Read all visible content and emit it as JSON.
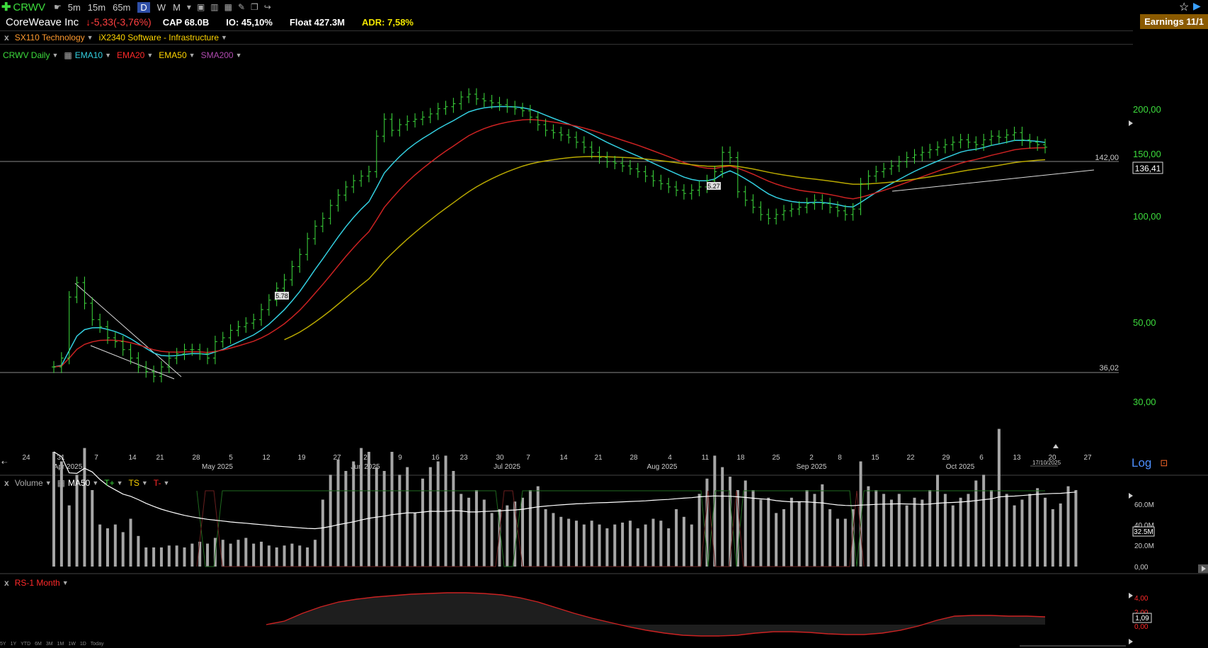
{
  "toolbar": {
    "symbol": "CRWV",
    "timeframes": [
      "5m",
      "15m",
      "65m",
      "D",
      "W",
      "M"
    ],
    "active_timeframe": "D"
  },
  "info": {
    "company": "CoreWeave Inc",
    "change": "-5,33(-3,76%)",
    "cap": "CAP 68.0B",
    "io": "IO: 45,10%",
    "float": "Float 427.3M",
    "adr": "ADR: 7,58%",
    "earnings": "Earnings 11/1"
  },
  "sector": {
    "sector": "SX110 Technology",
    "industry": "iX2340 Software - Infrastructure"
  },
  "indicators": {
    "title": "CRWV Daily",
    "items": [
      {
        "label": "EMA10",
        "color": "#33cfe0"
      },
      {
        "label": "EMA20",
        "color": "#ff2a2a"
      },
      {
        "label": "EMA50",
        "color": "#ffd500"
      },
      {
        "label": "SMA200",
        "color": "#b04ab0"
      }
    ]
  },
  "price_axis": {
    "labels": [
      "200,00",
      "150,00",
      "100,00",
      "50,00",
      "30,00"
    ],
    "last_price": "136,41",
    "hline_upper": "142,00",
    "hline_lower": "36,02",
    "log_label": "Log"
  },
  "annotations": {
    "a1": "5.78",
    "a2": "5.27"
  },
  "date_axis": {
    "days": [
      "24",
      "31",
      "7",
      "14",
      "21",
      "28",
      "5",
      "12",
      "19",
      "27",
      "2",
      "9",
      "16",
      "23",
      "30",
      "7",
      "14",
      "21",
      "28",
      "4",
      "11",
      "18",
      "25",
      "2",
      "8",
      "15",
      "22",
      "29",
      "6",
      "13",
      "20",
      "27"
    ],
    "months": [
      "Apr 2025",
      "May 2025",
      "Jun 2025",
      "Jul 2025",
      "Aug 2025",
      "Sep 2025",
      "Oct 2025"
    ],
    "current_date": "17/10/2025"
  },
  "volume_pane": {
    "title": "Volume",
    "ma": "MA50",
    "tplus": "T+",
    "ts": "TS",
    "tminus": "T-",
    "axis": [
      "60.0M",
      "40.0M",
      "20.0M",
      "0,00"
    ],
    "current": "32.5M"
  },
  "rs_pane": {
    "title": "RS-1 Month",
    "axis": [
      "4,00",
      "2,00",
      "0,00"
    ],
    "current": "1,09"
  },
  "ranges": [
    "5Y",
    "1Y",
    "YTD",
    "6M",
    "3M",
    "1M",
    "1W",
    "1D",
    "Today"
  ],
  "colors": {
    "up": "#3ddc3d",
    "ema10": "#33cfe0",
    "ema20": "#cc2222",
    "ema50": "#b8a800",
    "volume": "#a6a6a6"
  },
  "chart_data": {
    "type": "bar",
    "title": "CRWV Daily",
    "scale": "log",
    "ylim": [
      25,
      230
    ],
    "series": [
      {
        "name": "CRWV Daily",
        "values": [
          38,
          40,
          57,
          62,
          55,
          50,
          48,
          45,
          44,
          42,
          40,
          38,
          37,
          36,
          38,
          40,
          41,
          42,
          42,
          41,
          40,
          44,
          45,
          47,
          48,
          49,
          50,
          53,
          56,
          60,
          63,
          68,
          73,
          80,
          86,
          90,
          97,
          103,
          108,
          112,
          115,
          118,
          145,
          160,
          150,
          155,
          158,
          160,
          162,
          165,
          170,
          172,
          175,
          182,
          185,
          180,
          178,
          176,
          174,
          172,
          170,
          168,
          162,
          155,
          150,
          148,
          146,
          144,
          140,
          136,
          132,
          128,
          125,
          124,
          122,
          120,
          118,
          115,
          112,
          110,
          108,
          106,
          104,
          106,
          108,
          112,
          118,
          132,
          128,
          105,
          100,
          96,
          92,
          90,
          92,
          94,
          95,
          96,
          98,
          100,
          98,
          96,
          94,
          92,
          95,
          110,
          115,
          118,
          120,
          122,
          125,
          128,
          130,
          132,
          134,
          136,
          138,
          140,
          142,
          140,
          138,
          142,
          145,
          144,
          146,
          148,
          142,
          140,
          138,
          136
        ]
      },
      {
        "name": "EMA10",
        "values": []
      },
      {
        "name": "EMA20",
        "values": []
      },
      {
        "name": "EMA50",
        "values": []
      },
      {
        "name": "Volume",
        "values": [
          60,
          55,
          32,
          48,
          62,
          40,
          22,
          20,
          22,
          18,
          25,
          16,
          10,
          10,
          10,
          11,
          11,
          10,
          12,
          13,
          12,
          15,
          14,
          12,
          14,
          15,
          12,
          13,
          11,
          10,
          11,
          12,
          11,
          10,
          14,
          35,
          48,
          56,
          50,
          55,
          62,
          60,
          52,
          50,
          60,
          48,
          52,
          28,
          46,
          52,
          55,
          58,
          50,
          38,
          36,
          40,
          35,
          28,
          30,
          32,
          34,
          36,
          40,
          42,
          30,
          28,
          26,
          25,
          24,
          22,
          24,
          22,
          20,
          22,
          23,
          24,
          20,
          22,
          25,
          24,
          20,
          30,
          26,
          22,
          38,
          46,
          58,
          52,
          47,
          40,
          45,
          40,
          35,
          36,
          28,
          30,
          36,
          34,
          40,
          38,
          43,
          30,
          25,
          25,
          30,
          55,
          42,
          40,
          38,
          35,
          38,
          32,
          36,
          35,
          40,
          48,
          38,
          32,
          36,
          38,
          45,
          48,
          40,
          72,
          38,
          32,
          35,
          38,
          41,
          36,
          30,
          33,
          42,
          40
        ]
      }
    ],
    "rs": {
      "name": "RS-1 Month",
      "values": [
        0,
        0.5,
        1.6,
        2.5,
        3.2,
        3.6,
        3.9,
        4.1,
        4.3,
        4.4,
        4.5,
        4.5,
        4.4,
        4.2,
        3.8,
        3.2,
        2.4,
        1.6,
        0.9,
        0.3,
        -0.3,
        -0.8,
        -1.2,
        -1.5,
        -1.6,
        -1.6,
        -1.5,
        -1.2,
        -1.0,
        -1.0,
        -1.1,
        -1.3,
        -1.4,
        -1.4,
        -1.2,
        -0.8,
        -0.2,
        0.6,
        1.2,
        1.3,
        1.3,
        1.2,
        1.2,
        1.1
      ]
    }
  }
}
